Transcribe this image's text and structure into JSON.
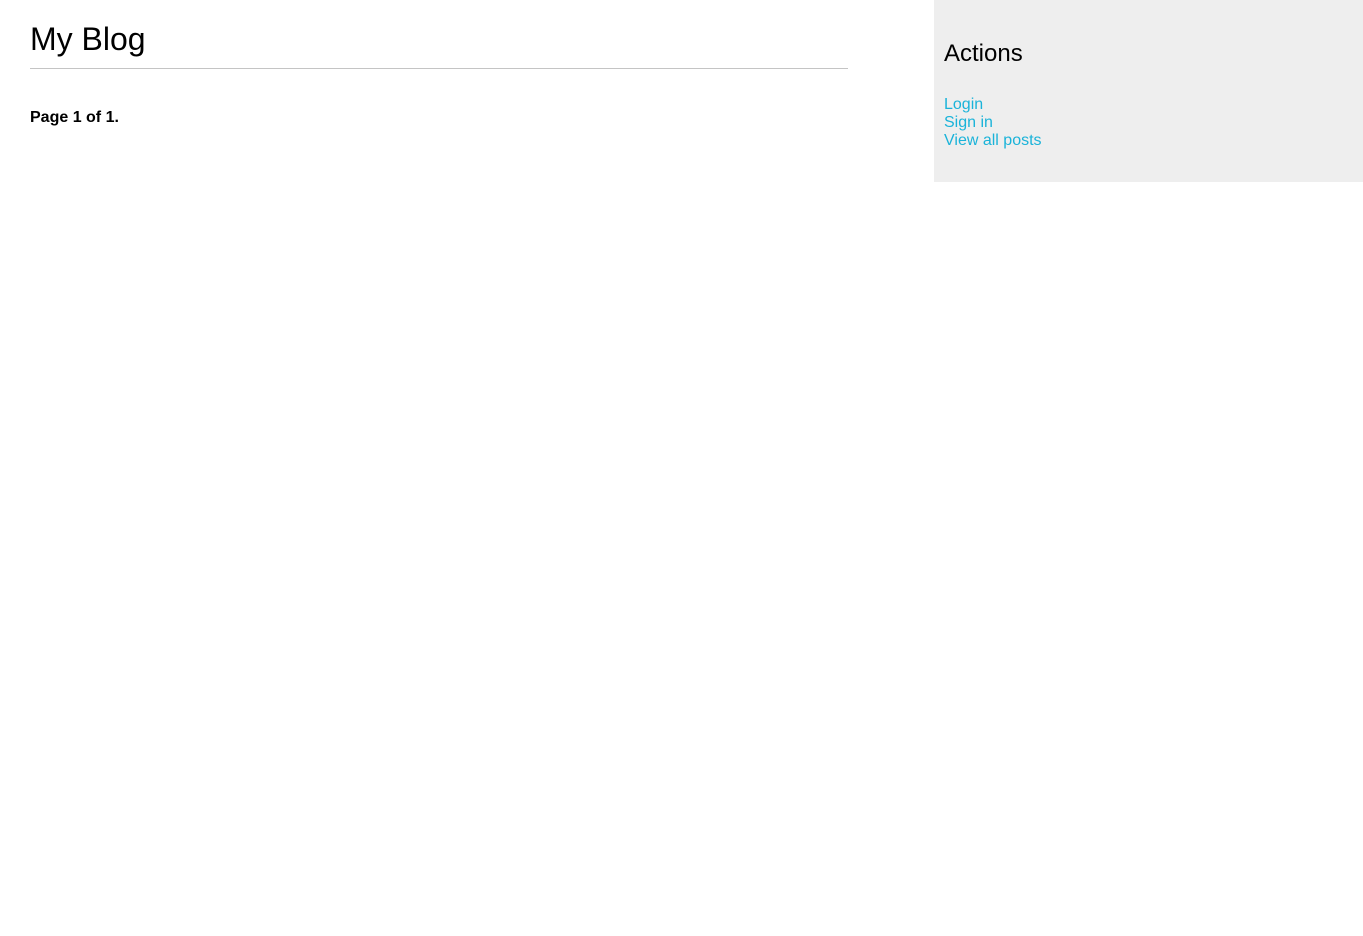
{
  "header": {
    "title": "My Blog"
  },
  "main": {
    "pagination_text": "Page 1 of 1."
  },
  "sidebar": {
    "title": "Actions",
    "links": [
      {
        "label": "Login"
      },
      {
        "label": "Sign in"
      },
      {
        "label": "View all posts"
      }
    ]
  },
  "colors": {
    "link": "#1ab3d9",
    "sidebar_background": "#eeeeee",
    "rule": "#c4c4c4"
  }
}
